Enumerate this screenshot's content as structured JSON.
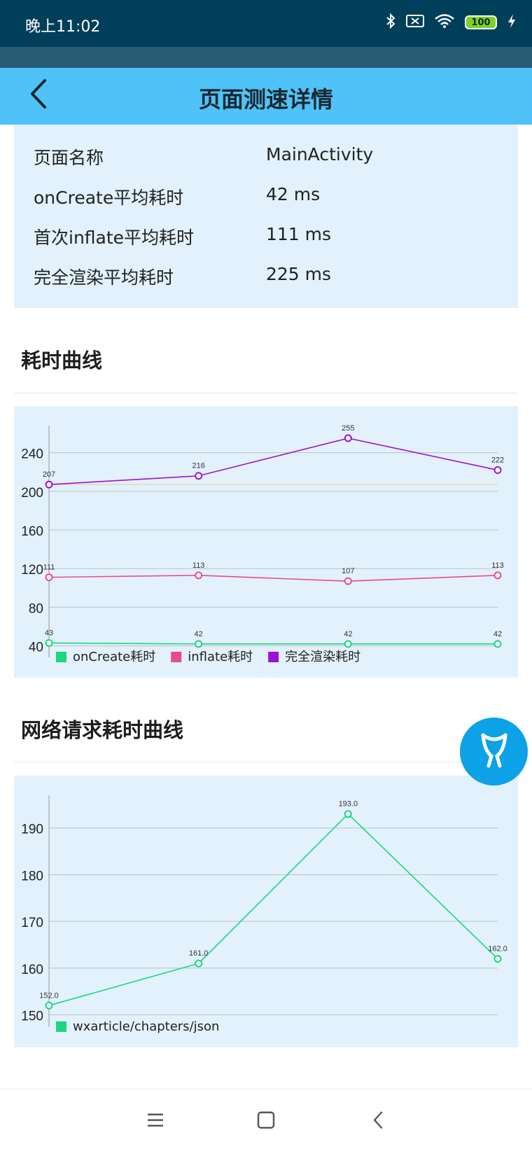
{
  "status_bar": {
    "time": "晚上11:02",
    "battery": "100"
  },
  "app_bar": {
    "title": "页面测速详情"
  },
  "info": [
    {
      "label": "页面名称",
      "value": "MainActivity"
    },
    {
      "label": "onCreate平均耗时",
      "value": "42 ms"
    },
    {
      "label": "首次inflate平均耗时",
      "value": "111 ms"
    },
    {
      "label": "完全渲染平均耗时",
      "value": "225 ms"
    }
  ],
  "sections": {
    "time_curve": "耗时曲线",
    "network_curve": "网络请求耗时曲线"
  },
  "colors": {
    "app_bar": "#4fc3f7",
    "card_bg": "#e2f1fc",
    "green": "#1ed680",
    "pink": "#e64c8b",
    "purple": "#9b12d6",
    "fab": "#0da2e7"
  },
  "icons": {
    "back": "chevron-left-icon",
    "fab": "app-logo-icon",
    "nav_menu": "menu-icon",
    "nav_home": "square-icon",
    "nav_back": "back-icon"
  },
  "chart_data": [
    {
      "type": "line",
      "x_count": 4,
      "y_ticks": [
        40,
        80,
        120,
        160,
        200,
        240
      ],
      "ylim": [
        31,
        268
      ],
      "grid": true,
      "legend_position": "bottom-left",
      "limit_line": 207,
      "series": [
        {
          "name": "onCreate耗时",
          "color": "#1ed680",
          "values": [
            43,
            42,
            42,
            42
          ],
          "labels": [
            "43",
            "42",
            "42",
            "42"
          ]
        },
        {
          "name": "inflate耗时",
          "color": "#e64c8b",
          "values": [
            111,
            113,
            107,
            113
          ],
          "labels": [
            "111",
            "113",
            "107",
            "113"
          ]
        },
        {
          "name": "完全渲染耗时",
          "color": "#9b12d6",
          "values": [
            207,
            216,
            255,
            222
          ],
          "labels": [
            "207",
            "216",
            "255",
            "222"
          ]
        }
      ]
    },
    {
      "type": "line",
      "x_count": 4,
      "y_ticks": [
        150,
        160,
        170,
        180,
        190
      ],
      "ylim": [
        148,
        197
      ],
      "grid": true,
      "legend_position": "bottom-left",
      "series": [
        {
          "name": "wxarticle/chapters/json",
          "color": "#1ed680",
          "values": [
            152.0,
            161.0,
            193.0,
            162.0
          ],
          "labels": [
            "152.0",
            "161.0",
            "193.0",
            "162.0"
          ]
        }
      ]
    }
  ]
}
